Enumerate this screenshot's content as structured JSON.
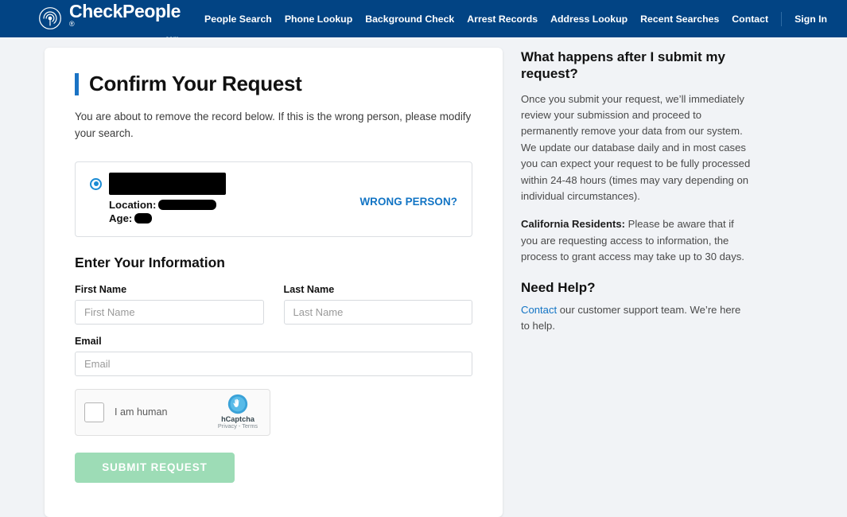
{
  "navbar": {
    "logo": {
      "icon": "fingerprint-icon",
      "name": "CheckPeople",
      "registered": "®",
      "tld": ".com"
    },
    "links": [
      {
        "label": "People Search"
      },
      {
        "label": "Phone Lookup"
      },
      {
        "label": "Background Check"
      },
      {
        "label": "Arrest Records"
      },
      {
        "label": "Address Lookup"
      },
      {
        "label": "Recent Searches"
      },
      {
        "label": "Contact"
      }
    ],
    "sign_in": "Sign In"
  },
  "card": {
    "title": "Confirm Your Request",
    "subtitle": "You are about to remove the record below. If this is the wrong person, please modify your search.",
    "record": {
      "radio_selected": true,
      "name_redacted": "",
      "location_label": "Location:",
      "location_redacted": "",
      "age_label": "Age:",
      "age_redacted": "",
      "wrong_person_link": "WRONG PERSON?"
    },
    "form": {
      "heading": "Enter Your Information",
      "fields": [
        {
          "label": "First Name",
          "placeholder": "First Name",
          "value": ""
        },
        {
          "label": "Last Name",
          "placeholder": "Last Name",
          "value": ""
        },
        {
          "label": "Email",
          "placeholder": "Email",
          "value": ""
        }
      ],
      "captcha": {
        "checked": false,
        "label": "I am human",
        "brand": "hCaptcha",
        "terms": "Privacy - Terms",
        "icon": "hcaptcha-hand-icon"
      },
      "submit_label": "SUBMIT REQUEST"
    }
  },
  "sidebar": {
    "heading_1": "What happens after I submit my request?",
    "paragraph_1": "Once you submit your request, we’ll immediately review your submission and proceed to permanently remove your data from our system. We update our database daily and in most cases you can expect your request to be fully processed within 24-48 hours (times may vary depending on individual circumstances).",
    "california_label": "California Residents:",
    "california_text": " Please be aware that if you are requesting access to information, the process to grant access may take up to 30 days.",
    "heading_2": "Need Help?",
    "help_link": "Contact",
    "help_text": " our customer support team. We’re here to help."
  },
  "colors": {
    "navbar_bg": "#024484",
    "page_bg": "#f1f3f6",
    "accent_blue": "#1274c4",
    "title_bar_blue": "#1a73c4",
    "submit_green": "#9ddcb6",
    "redaction_black": "#000000"
  }
}
